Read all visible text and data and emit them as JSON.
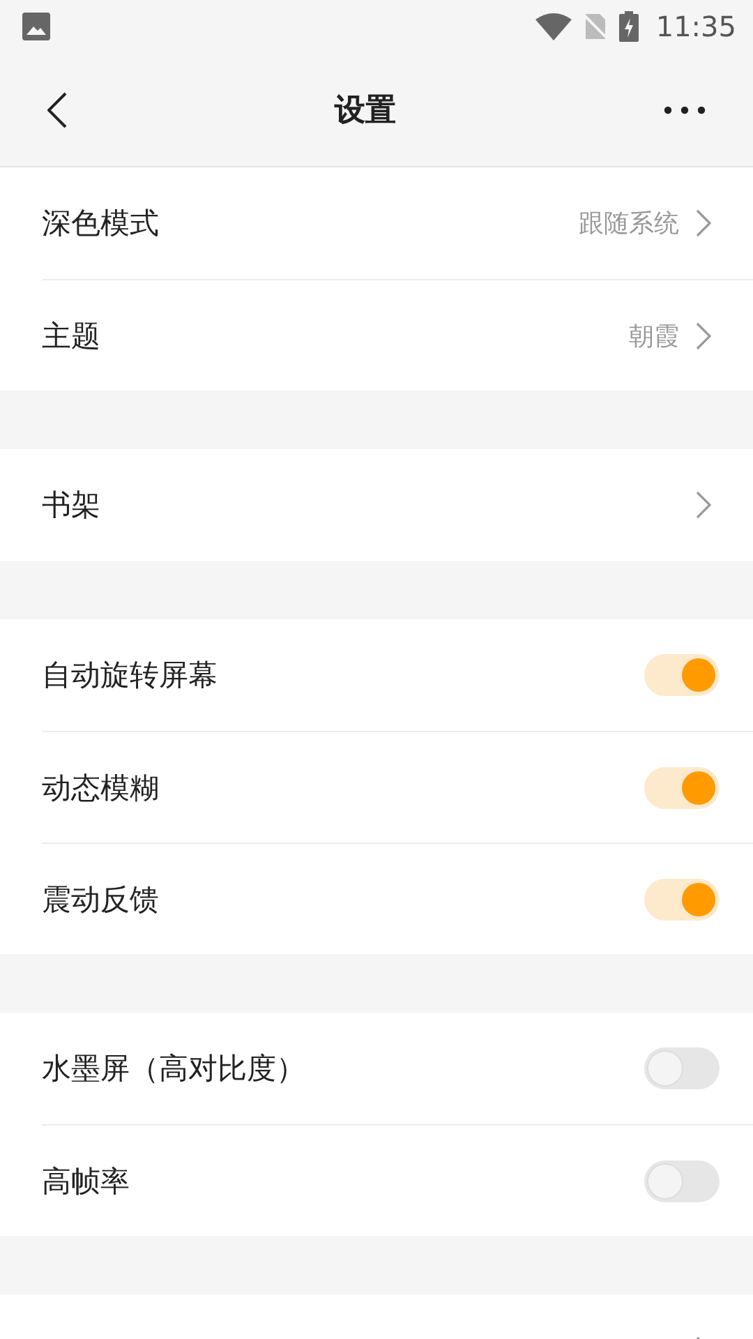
{
  "status_bar": {
    "time": "11:35"
  },
  "header": {
    "title": "设置"
  },
  "sections": [
    {
      "items": [
        {
          "kind": "link",
          "label": "深色模式",
          "value": "跟随系统"
        },
        {
          "kind": "link",
          "label": "主题",
          "value": "朝霞"
        }
      ]
    },
    {
      "items": [
        {
          "kind": "link",
          "label": "书架"
        }
      ]
    },
    {
      "items": [
        {
          "kind": "switch",
          "label": "自动旋转屏幕",
          "on": true
        },
        {
          "kind": "switch",
          "label": "动态模糊",
          "on": true
        },
        {
          "kind": "switch",
          "label": "震动反馈",
          "on": true
        }
      ]
    },
    {
      "items": [
        {
          "kind": "switch",
          "label": "水墨屏（高对比度）",
          "on": false
        },
        {
          "kind": "switch",
          "label": "高帧率",
          "on": false
        }
      ]
    },
    {
      "items": [
        {
          "kind": "link"
        }
      ]
    }
  ]
}
